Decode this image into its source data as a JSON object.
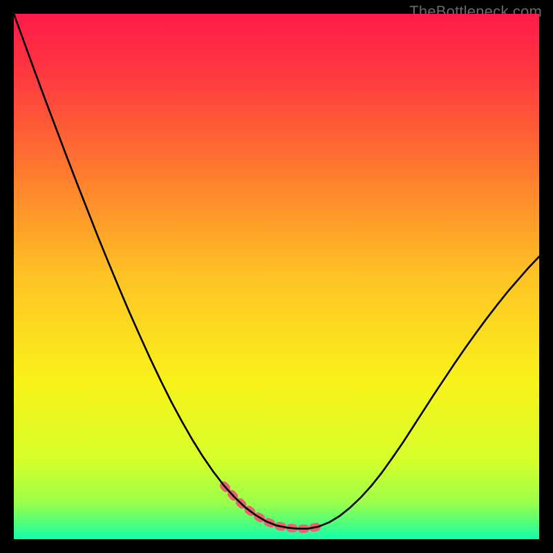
{
  "watermark_text": "TheBottleneck.com",
  "chart_data": {
    "type": "line",
    "title": "",
    "xlabel": "",
    "ylabel": "",
    "xlim": [
      0,
      100
    ],
    "ylim": [
      0,
      100
    ],
    "x": [
      0,
      2,
      4,
      6,
      8,
      10,
      12,
      14,
      16,
      18,
      20,
      22,
      24,
      26,
      28,
      30,
      32,
      34,
      36,
      38,
      40,
      42,
      44,
      46,
      48,
      50,
      52,
      54,
      56,
      58,
      60,
      62,
      64,
      66,
      68,
      70,
      72,
      74,
      76,
      78,
      80,
      82,
      84,
      86,
      88,
      90,
      92,
      94,
      96,
      98,
      100
    ],
    "series": [
      {
        "name": "bottleneck-curve",
        "values": [
          100,
          94.5,
          89,
          83.6,
          78.3,
          73,
          67.8,
          62.7,
          57.6,
          52.7,
          47.9,
          43.2,
          38.7,
          34.3,
          30.1,
          26.1,
          22.4,
          18.9,
          15.7,
          12.8,
          10.2,
          8.0,
          6.1,
          4.6,
          3.4,
          2.6,
          2.2,
          2.0,
          2.0,
          2.4,
          3.2,
          4.4,
          6.0,
          7.9,
          10.1,
          12.6,
          15.4,
          18.3,
          21.4,
          24.5,
          27.6,
          30.6,
          33.6,
          36.5,
          39.3,
          42.0,
          44.6,
          47.1,
          49.4,
          51.7,
          53.8
        ]
      },
      {
        "name": "highlight-overlay",
        "x_range": [
          40,
          58
        ],
        "values_at_x": [
          10.2,
          8.0,
          6.1,
          4.6,
          3.4,
          2.6,
          2.2,
          2.0,
          2.0,
          2.4
        ]
      }
    ],
    "gradient_stops": [
      {
        "offset": 0.0,
        "color": "#ff1a4a"
      },
      {
        "offset": 0.12,
        "color": "#ff3a3f"
      },
      {
        "offset": 0.3,
        "color": "#ff7a2e"
      },
      {
        "offset": 0.5,
        "color": "#ffc324"
      },
      {
        "offset": 0.7,
        "color": "#f9f21a"
      },
      {
        "offset": 0.85,
        "color": "#d6ff2a"
      },
      {
        "offset": 0.93,
        "color": "#9cff4a"
      },
      {
        "offset": 0.97,
        "color": "#4dff7a"
      },
      {
        "offset": 1.0,
        "color": "#14ffb0"
      }
    ],
    "highlight_color": "#e8656f",
    "curve_color": "#000000"
  }
}
